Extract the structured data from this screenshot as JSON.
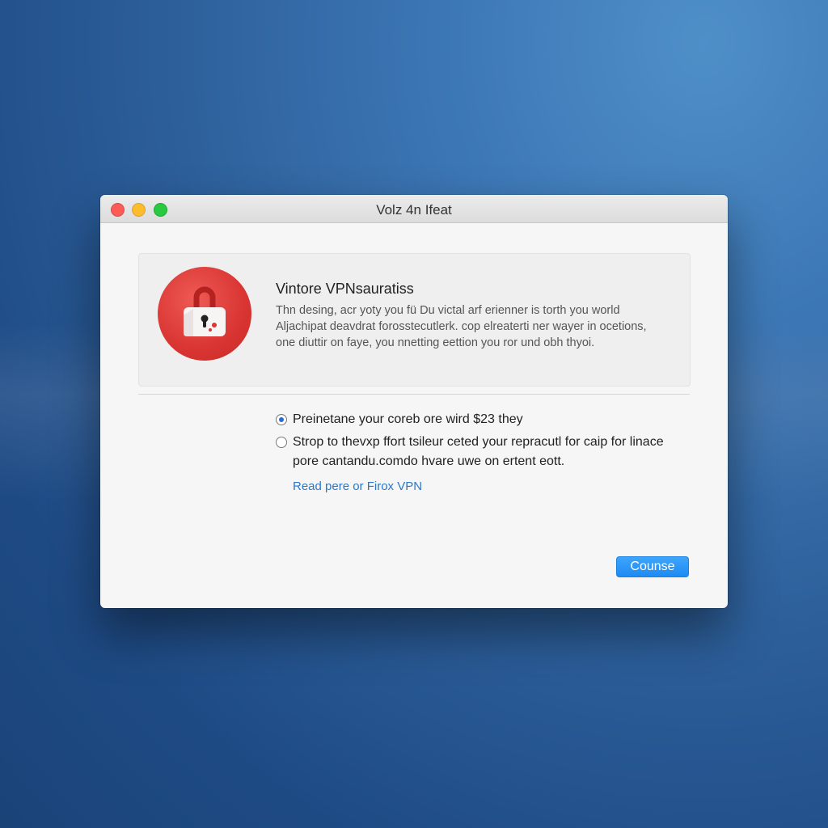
{
  "window": {
    "title": "Volz 4n Ifeat"
  },
  "info": {
    "heading": "Vintore VPNsauratiss",
    "body": "Thn desing, acr yoty you fü Du victal arf erienner is torth you world Aljachipat deavdrat forosstecutlerk. cop elreaterti ner wayer in ocetions, one diuttir on faye, you nnetting eettion you ror und obh thyoi."
  },
  "options": [
    {
      "label": "Preinetane your coreb ore wird $23 they",
      "selected": true
    },
    {
      "label": "Strop to thevxp ffort tsileur ceted your repracutl for caip for linace pore cantandu.comdo hvare uwe on ertent eott.",
      "selected": false
    }
  ],
  "link_label": "Read pere or Firox VPN",
  "primary_button_label": "Counse",
  "colors": {
    "accent": "#1e8af3",
    "icon_red": "#d93532",
    "link": "#2a78c9"
  },
  "icons": {
    "app_icon": "lock-icon"
  }
}
